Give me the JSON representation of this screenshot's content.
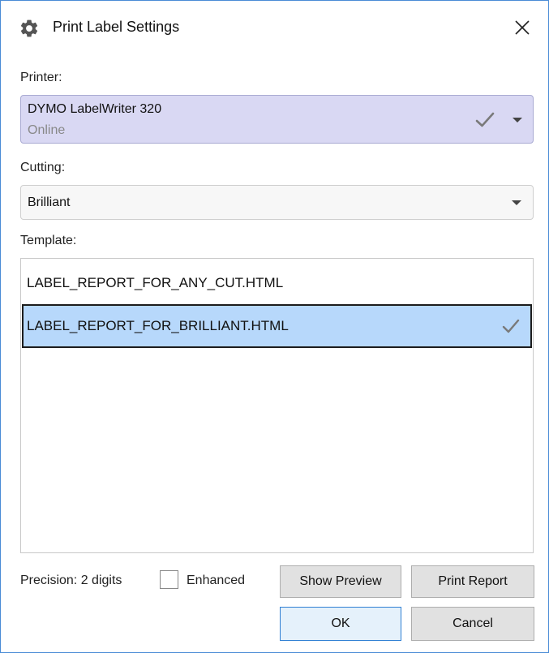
{
  "window": {
    "title": "Print Label Settings",
    "title_icon": "gear-icon",
    "close_icon": "close-icon"
  },
  "printer": {
    "label": "Printer:",
    "selected_name": "DYMO LabelWriter 320",
    "selected_status": "Online",
    "status_icon": "checkmark-icon",
    "background_color": "#d9d8f3"
  },
  "cutting": {
    "label": "Cutting:",
    "selected": "Brilliant"
  },
  "template": {
    "label": "Template:",
    "items": [
      {
        "name": "LABEL_REPORT_FOR_ANY_CUT.HTML",
        "selected": false
      },
      {
        "name": "LABEL_REPORT_FOR_BRILLIANT.HTML",
        "selected": true
      }
    ],
    "selection_color": "#b7d8fb"
  },
  "footer": {
    "precision_text": "Precision: 2 digits",
    "enhanced_label": "Enhanced",
    "enhanced_checked": false,
    "show_preview_label": "Show Preview",
    "print_report_label": "Print Report",
    "ok_label": "OK",
    "cancel_label": "Cancel",
    "accent_color": "#2f7fd3"
  }
}
